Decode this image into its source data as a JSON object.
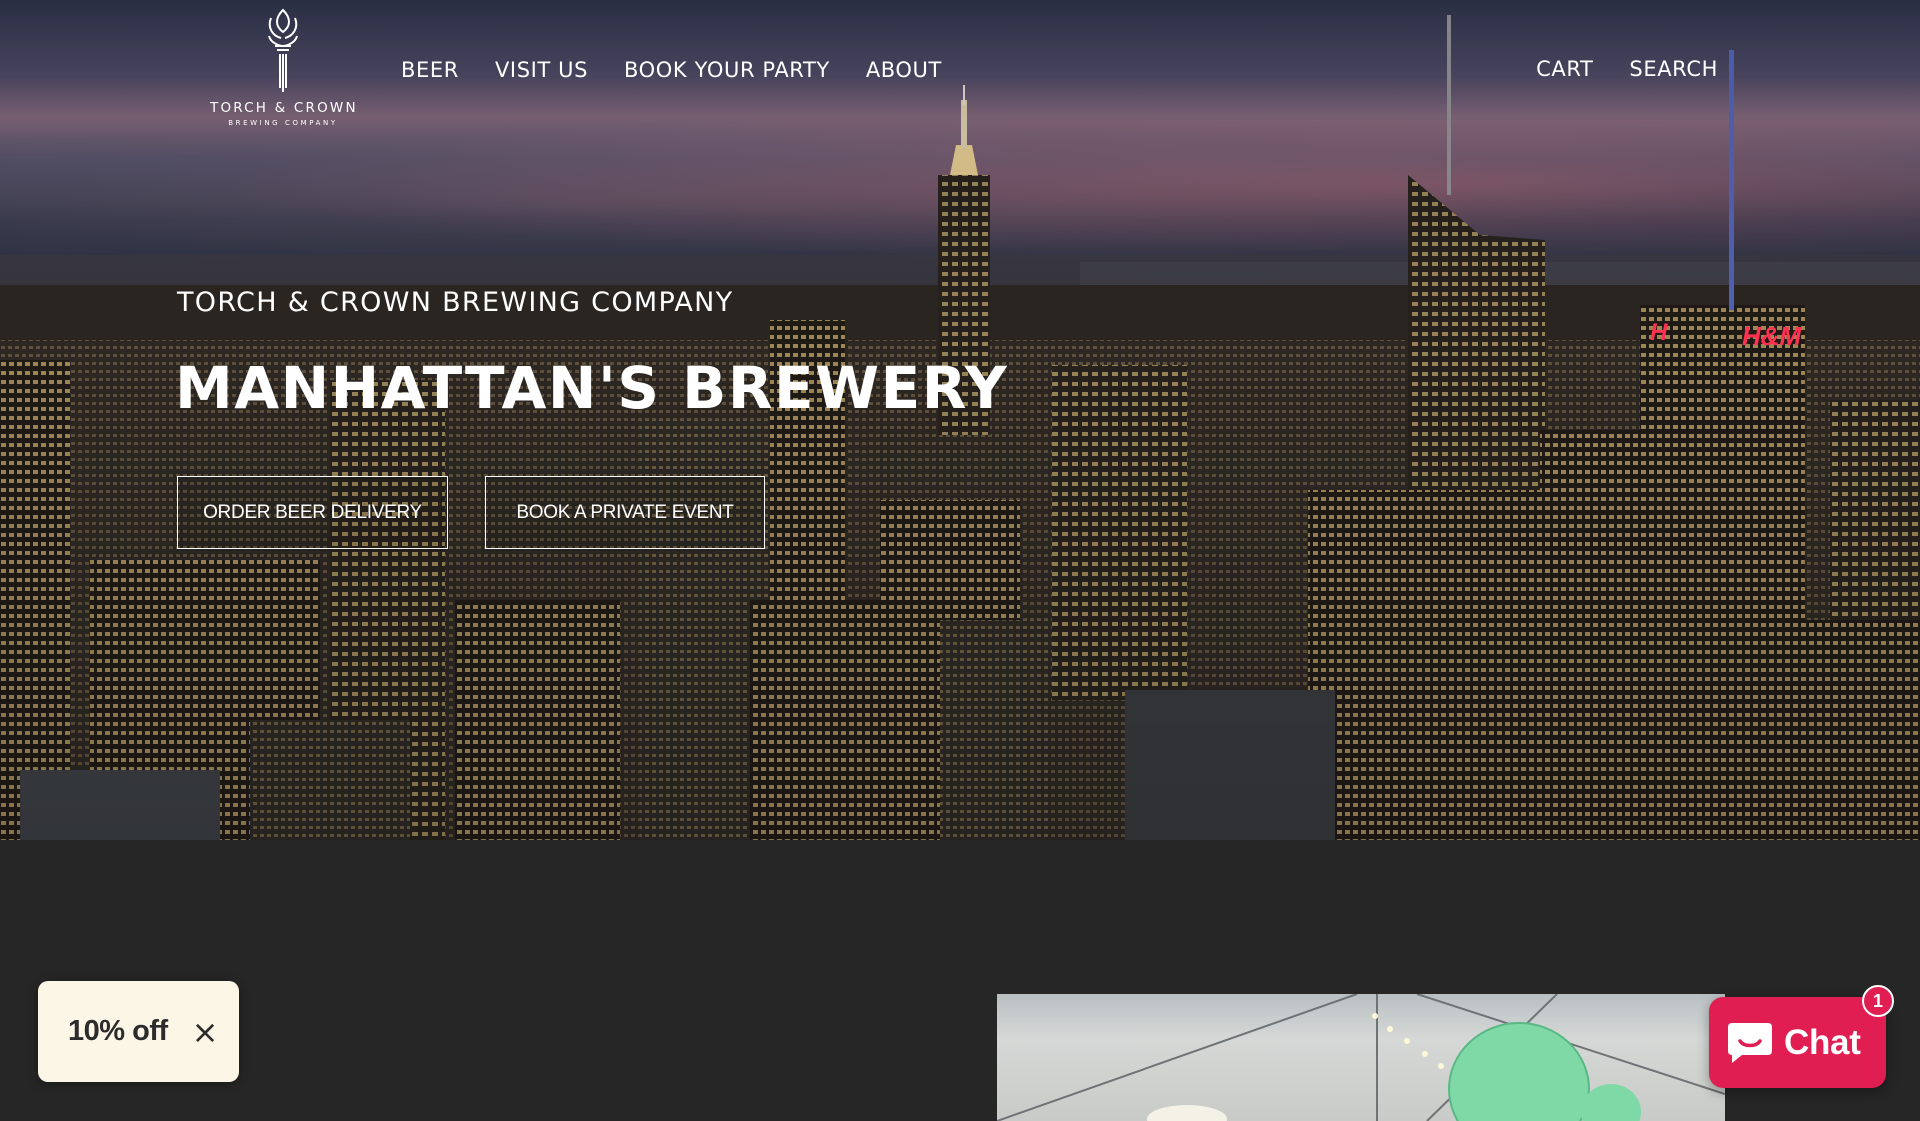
{
  "header": {
    "logo": {
      "name": "TORCH & CROWN",
      "sub": "BREWING COMPANY"
    },
    "nav": [
      {
        "label": "BEER"
      },
      {
        "label": "VISIT US"
      },
      {
        "label": "BOOK YOUR PARTY"
      },
      {
        "label": "ABOUT"
      }
    ],
    "utility": {
      "cart_label": "CART",
      "search_label": "SEARCH"
    }
  },
  "hero": {
    "eyebrow": "TORCH & CROWN BREWING COMPANY",
    "title": "MANHATTAN'S BREWERY",
    "buttons": {
      "order_delivery": "ORDER BEER DELIVERY",
      "book_event": "BOOK A PRIVATE EVENT"
    }
  },
  "discount": {
    "label": "10% off",
    "close_icon": "×"
  },
  "chat": {
    "label": "Chat",
    "badge_count": "1",
    "icon": "chat-bubble-icon",
    "color": "#e01e52"
  },
  "colors": {
    "page_bg": "#262626",
    "discount_bg": "#fbf6e6",
    "chat": "#e01e52"
  }
}
